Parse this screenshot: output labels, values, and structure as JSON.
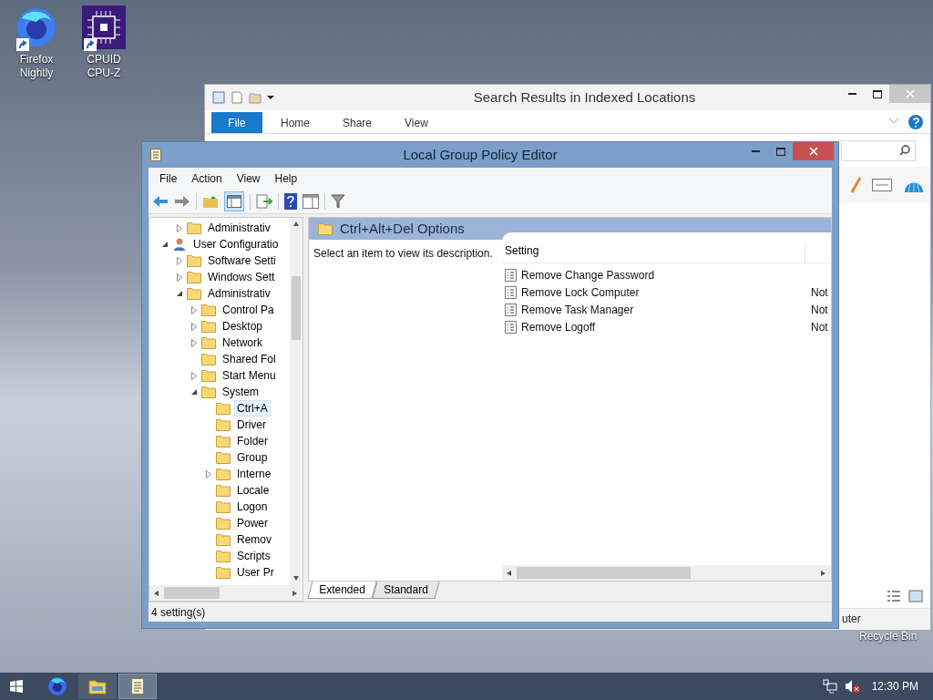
{
  "desktop_icons": [
    {
      "kind": "firefox",
      "label": "Firefox Nightly"
    },
    {
      "kind": "cpuz",
      "label": "CPUID CPU-Z"
    }
  ],
  "recycle_bin": {
    "label": "Recycle Bin"
  },
  "explorer": {
    "title": "Search Results in Indexed Locations",
    "ribbon_tabs": [
      {
        "label": "File",
        "selected": true
      },
      {
        "label": "Home",
        "selected": false
      },
      {
        "label": "Share",
        "selected": false
      },
      {
        "label": "View",
        "selected": false
      }
    ],
    "status_text": "uter"
  },
  "gpe": {
    "title": "Local Group Policy Editor",
    "menu": [
      "File",
      "Action",
      "View",
      "Help"
    ],
    "tree": [
      {
        "kind": "continued",
        "label": "Administrativ",
        "expanded": false
      },
      {
        "kind": "user",
        "label": "User Configuratio",
        "expanded": true,
        "children": [
          {
            "label": "Software Setti",
            "expanded": false
          },
          {
            "label": "Windows Sett",
            "expanded": false
          },
          {
            "label": "Administrativ",
            "expanded": true,
            "children": [
              {
                "label": "Control Pa",
                "expanded": false
              },
              {
                "label": "Desktop",
                "expanded": false
              },
              {
                "label": "Network",
                "expanded": false
              },
              {
                "label": "Shared Fol"
              },
              {
                "label": "Start Menu",
                "expanded": false
              },
              {
                "label": "System",
                "expanded": true,
                "children": [
                  {
                    "label": "Ctrl+A",
                    "selected": true
                  },
                  {
                    "label": "Driver",
                    "selected": false
                  },
                  {
                    "label": "Folder",
                    "selected": false
                  },
                  {
                    "label": "Group",
                    "selected": false
                  },
                  {
                    "label": "Interne",
                    "expanded": false,
                    "selected": false
                  },
                  {
                    "label": "Locale",
                    "selected": false
                  },
                  {
                    "label": "Logon",
                    "selected": false
                  },
                  {
                    "label": "Power",
                    "selected": false
                  },
                  {
                    "label": "Remov",
                    "selected": false
                  },
                  {
                    "label": "Scripts",
                    "selected": false
                  },
                  {
                    "label": "User Pr",
                    "selected": false
                  }
                ]
              }
            ]
          }
        ]
      }
    ],
    "header": "Ctrl+Alt+Del Options",
    "description": "Select an item to view its description.",
    "columns": [
      "Setting"
    ],
    "rows": [
      {
        "setting": "Remove Change Password"
      },
      {
        "setting": "Remove Lock Computer",
        "column_2": "Not"
      },
      {
        "setting": "Remove Task Manager",
        "column_2": "Not"
      },
      {
        "setting": "Remove Logoff",
        "column_2": "Not"
      }
    ],
    "tabs": [
      {
        "label": "Extended",
        "selected": true
      },
      {
        "label": "Standard",
        "selected": false
      }
    ],
    "status": "4 setting(s)"
  },
  "taskbar": {
    "apps": [
      {
        "kind": "firefox",
        "selected": false
      },
      {
        "kind": "explorer",
        "selected": false
      },
      {
        "kind": "gpe",
        "selected": true
      }
    ],
    "clock": "12:30 PM"
  }
}
